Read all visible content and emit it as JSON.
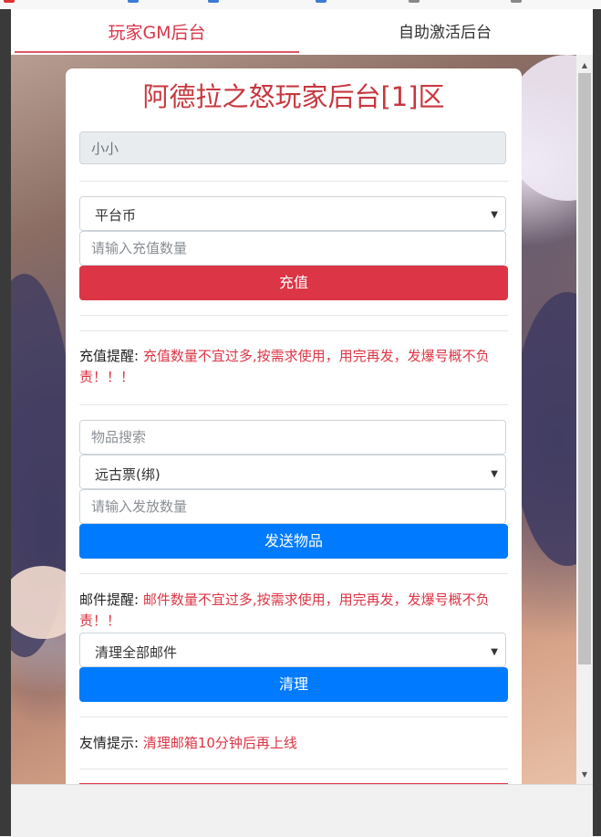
{
  "tabs": [
    {
      "label": "玩家GM后台"
    },
    {
      "label": "自助激活后台"
    }
  ],
  "panel": {
    "title": "阿德拉之怒玩家后台[1]区",
    "player_name": "小小",
    "currency_select": "平台币",
    "recharge_placeholder": "请输入充值数量",
    "recharge_button": "充值",
    "recharge_note_label": "充值提醒:",
    "recharge_note_text": "充值数量不宜过多,按需求使用，用完再发，发爆号概不负责！！！",
    "item_search_placeholder": "物品搜索",
    "item_select": "远古票(绑)",
    "item_qty_placeholder": "请输入发放数量",
    "send_item_button": "发送物品",
    "mail_note_label": "邮件提醒:",
    "mail_note_text": "邮件数量不宜过多,按需求使用，用完再发，发爆号概不负责！！",
    "mail_select": "清理全部邮件",
    "clear_button": "清理",
    "tip_label": "友情提示:",
    "tip_text": "清理邮箱10分钟后再上线"
  },
  "colors": {
    "accent_red": "#dc3545",
    "accent_blue": "#007bff",
    "title_red": "#c8373f"
  }
}
